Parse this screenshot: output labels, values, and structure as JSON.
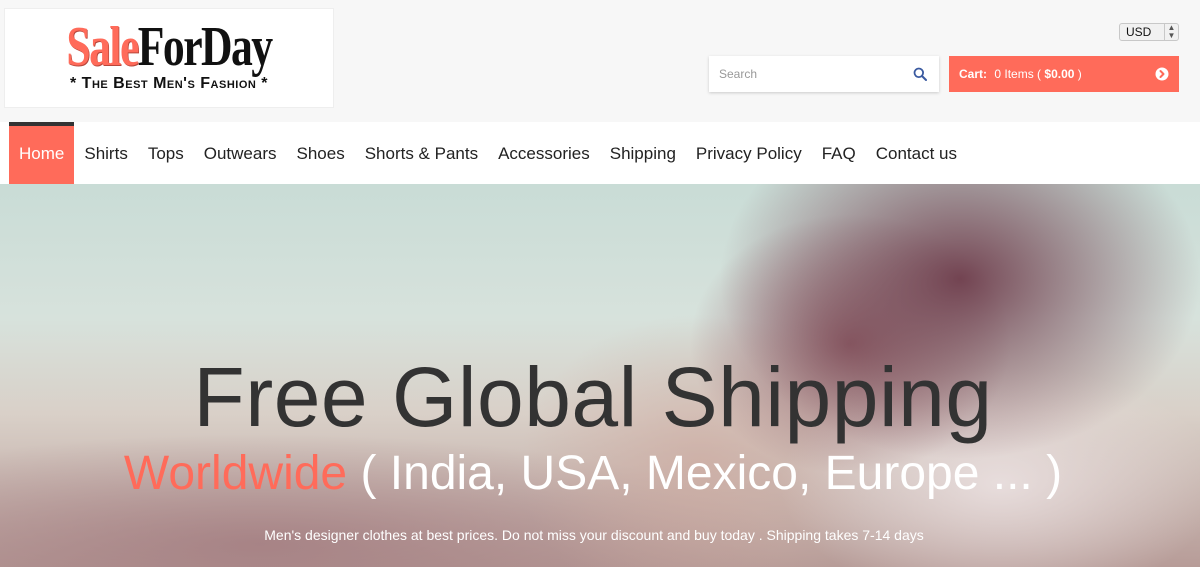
{
  "brand": {
    "name_part1": "Sale",
    "name_part2": "ForDay",
    "tagline": "* The Best Men's Fashion *",
    "accent_color": "#ff6b5a"
  },
  "header": {
    "currency": "USD",
    "search_placeholder": "Search",
    "search_icon": "search-icon",
    "cart": {
      "label": "Cart:",
      "items": "0 Items (",
      "total": "$0.00",
      "close": ")",
      "icon": "chevron-right-circle-icon"
    }
  },
  "nav": {
    "items": [
      {
        "label": "Home",
        "active": true
      },
      {
        "label": "Shirts"
      },
      {
        "label": "Tops"
      },
      {
        "label": "Outwears"
      },
      {
        "label": "Shoes"
      },
      {
        "label": "Shorts & Pants"
      },
      {
        "label": "Accessories"
      },
      {
        "label": "Shipping"
      },
      {
        "label": "Privacy Policy"
      },
      {
        "label": "FAQ"
      },
      {
        "label": "Contact us"
      }
    ]
  },
  "hero": {
    "title": "Free Global Shipping",
    "subtitle_highlight": "Worldwide",
    "subtitle_rest": " ( India, USA, Mexico, Europe ... )",
    "text": "Men's designer clothes at best prices. Do not miss your discount and buy today . Shipping takes 7-14 days"
  }
}
